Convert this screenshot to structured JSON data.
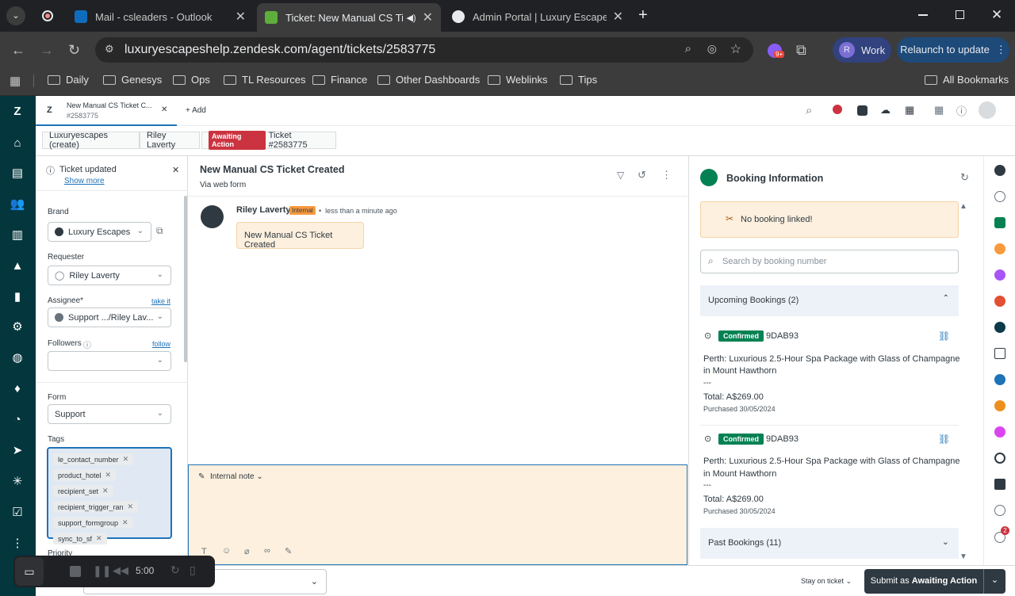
{
  "browser": {
    "tabs": [
      {
        "title": "Mail - csleaders - Outlook",
        "close": "✕"
      },
      {
        "title": "Ticket: New Manual CS Ticke",
        "close": "✕"
      },
      {
        "title": "Admin Portal | Luxury Escapes",
        "close": "✕"
      }
    ],
    "url": "luxuryescapeshelp.zendesk.com/agent/tickets/2583775",
    "profile_label": "Work",
    "profile_initial": "R",
    "relaunch_label": "Relaunch to update",
    "extension_badge": "9+",
    "bookmarks": [
      "Daily",
      "Genesys",
      "Ops",
      "TL Resources",
      "Finance",
      "Other Dashboards",
      "Weblinks",
      "Tips"
    ],
    "all_bookmarks": "All Bookmarks"
  },
  "zendesk": {
    "top_tab": {
      "title": "New Manual CS Ticket C...",
      "number": "#2583775"
    },
    "add_label": "Add",
    "breadcrumbs": {
      "org": "Luxuryescapes (create)",
      "user": "Riley Laverty",
      "status": "Awaiting Action",
      "ticket": "Ticket #2583775"
    },
    "notice": {
      "title": "Ticket updated",
      "link": "Show more"
    },
    "fields": {
      "brand_label": "Brand",
      "brand_value": "Luxury Escapes",
      "requester_label": "Requester",
      "requester_value": "Riley Laverty",
      "assignee_label": "Assignee*",
      "assignee_link": "take it",
      "assignee_value": "Support .../Riley Lav...",
      "followers_label": "Followers",
      "followers_link": "follow",
      "form_label": "Form",
      "form_value": "Support",
      "tags_label": "Tags",
      "tags": [
        "le_contact_number",
        "product_hotel",
        "recipient_set",
        "recipient_trigger_ran",
        "support_formgroup",
        "sync_to_sf"
      ],
      "priority_label": "Priority"
    },
    "conversation": {
      "title": "New Manual CS Ticket Created",
      "subtitle": "Via web form",
      "author": "Riley Laverty",
      "internal_badge": "Internal",
      "time": "less than a minute ago",
      "message": "New Manual CS Ticket Created",
      "composer_mode": "Internal note"
    },
    "booking": {
      "title": "Booking Information",
      "no_booking": "No booking linked!",
      "search_placeholder": "Search by booking number",
      "upcoming_label": "Upcoming Bookings (2)",
      "items": [
        {
          "status": "Confirmed",
          "code": "9DAB93",
          "name_line1": "Perth: Luxurious 2.5-Hour Spa Package with Glass of Champagne",
          "name_line2": "in Mount Hawthorn",
          "dash": "---",
          "total": "Total: A$269.00",
          "purchased": "Purchased 30/05/2024"
        },
        {
          "status": "Confirmed",
          "code": "9DAB93",
          "name_line1": "Perth: Luxurious 2.5-Hour Spa Package with Glass of Champagne",
          "name_line2": "in Mount Hawthorn",
          "dash": "---",
          "total": "Total: A$269.00",
          "purchased": "Purchased 30/05/2024"
        }
      ],
      "past_label": "Past Bookings (11)"
    },
    "bottom": {
      "timer": "5:00",
      "stay_label": "Stay on ticket",
      "submit_prefix": "Submit as ",
      "submit_status": "Awaiting Action"
    },
    "apps_badge": "2"
  },
  "colors": {
    "chrome_dark": "#202124",
    "zendesk_sidebar": "#03363d",
    "awaiting_red": "#cc3340",
    "confirmed_green": "#038153",
    "note_bg": "#fdf0de"
  }
}
